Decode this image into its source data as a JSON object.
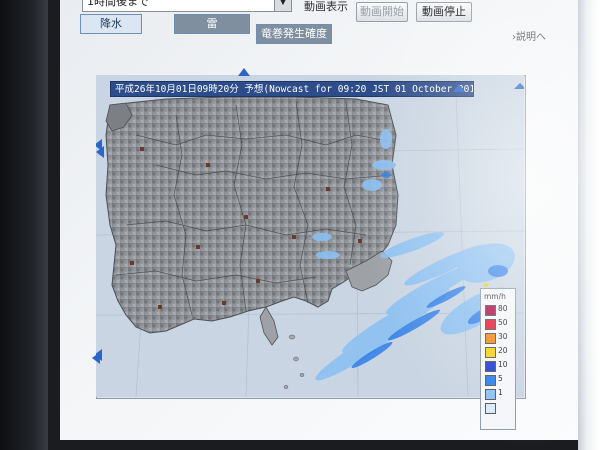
{
  "controls": {
    "range_select_value": "1時間後まで",
    "animation_label": "動画表示",
    "play_button": "動画開始",
    "stop_button": "動画停止",
    "help_link": "説明へ"
  },
  "tabs": [
    {
      "label": "降水",
      "active": true
    },
    {
      "label": "雷",
      "active": false
    },
    {
      "label": "竜巻発生確度",
      "active": false
    }
  ],
  "map": {
    "title": "平成26年10月01日09時20分 予想(Nowcast for 09:20 JST 01 October 2014)"
  },
  "legend": {
    "unit": "mm/h",
    "levels": [
      {
        "label": "80",
        "color": "#b0104a"
      },
      {
        "label": "50",
        "color": "#e0203a"
      },
      {
        "label": "30",
        "color": "#f08a20"
      },
      {
        "label": "20",
        "color": "#f2d21c"
      },
      {
        "label": "10",
        "color": "#1f3fd0"
      },
      {
        "label": "5",
        "color": "#2f7fe8"
      },
      {
        "label": "1",
        "color": "#8cc0f2"
      },
      {
        "label": "",
        "color": "#d7e9fb"
      }
    ]
  },
  "colors": {
    "title_bar": "#2d4c8a",
    "land_grey": "#8f9296",
    "sea": "#c9d5e2",
    "rain_light": "#8cc0f2",
    "rain_mid": "#2f7fe8",
    "nav_arrow": "#2a66c8"
  }
}
